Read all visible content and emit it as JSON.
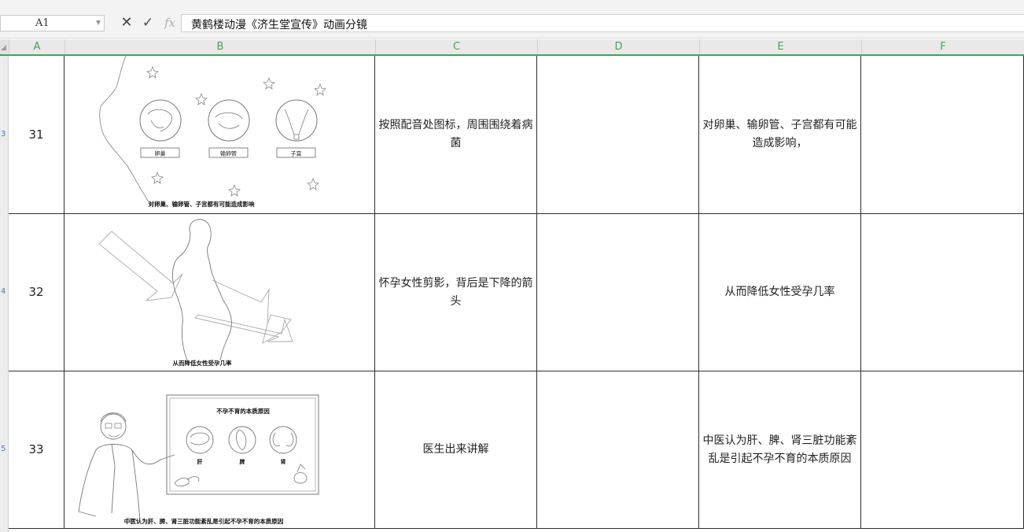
{
  "name_box": {
    "value": "A1"
  },
  "formula_bar": {
    "content": "黄鹤楼动漫《济生堂宣传》动画分镜",
    "fx_label": "fx"
  },
  "columns": [
    "A",
    "B",
    "C",
    "D",
    "E",
    "F"
  ],
  "rows": [
    {
      "num": "31",
      "c": "按照配音处图标，周围围绕着病菌",
      "d": "",
      "e": "对卵巢、输卵管、子宫都有可能造成影响，",
      "f": "",
      "sketch": {
        "caption": "对卵巢、输卵管、子宫都有可能造成影响",
        "labels": [
          "卵巢",
          "输卵管",
          "子宫"
        ]
      }
    },
    {
      "num": "32",
      "c": "怀孕女性剪影，背后是下降的箭头",
      "d": "",
      "e": "从而降低女性受孕几率",
      "f": "",
      "sketch": {
        "caption": "从而降低女性受孕几率"
      }
    },
    {
      "num": "33",
      "c": "医生出来讲解",
      "d": "",
      "e": "中医认为肝、脾、肾三脏功能紊乱是引起不孕不育的本质原因",
      "f": "",
      "sketch": {
        "board_title": "不孕不育的本质原因",
        "labels": [
          "肝",
          "脾",
          "肾"
        ],
        "caption": "中医认为肝、脾、肾三脏功能紊乱是引起不孕不育的本质原因"
      }
    }
  ],
  "colors": {
    "header_accent": "#3aa853",
    "row_number_marks": "#4a7fc0"
  }
}
